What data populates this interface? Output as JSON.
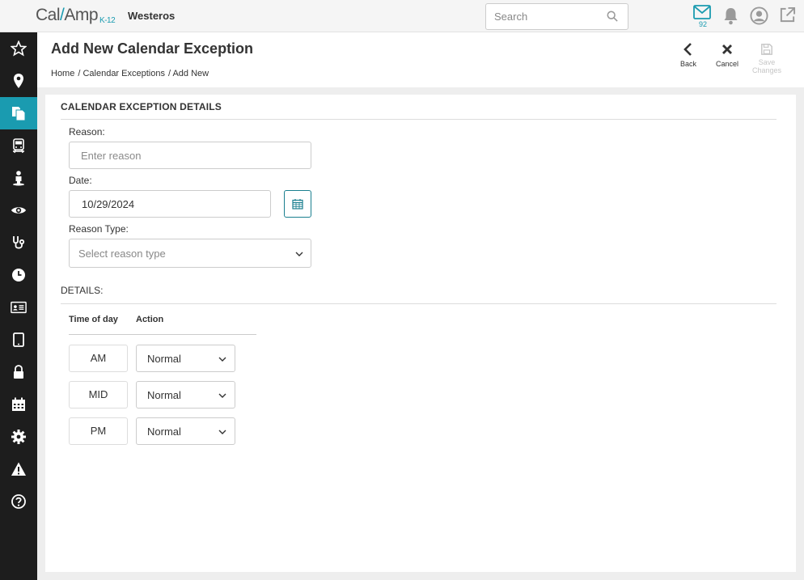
{
  "app": {
    "logo_text_a": "Cal",
    "logo_text_slash": "/",
    "logo_text_b": "Amp",
    "logo_suffix": "K-12",
    "district": "Westeros",
    "accent_color": "#1a9bb0"
  },
  "topbar": {
    "search_placeholder": "Search",
    "mail_count": "92",
    "icons": [
      "search-icon",
      "mail-icon",
      "bell-icon",
      "user-icon",
      "external-link-icon"
    ]
  },
  "sidebar": {
    "items": [
      {
        "icon": "star-icon"
      },
      {
        "icon": "map-pin-icon"
      },
      {
        "icon": "documents-icon",
        "active": true
      },
      {
        "icon": "bus-icon"
      },
      {
        "icon": "person-icon"
      },
      {
        "icon": "eye-icon"
      },
      {
        "icon": "stethoscope-icon"
      },
      {
        "icon": "clock-icon"
      },
      {
        "icon": "id-card-icon"
      },
      {
        "icon": "tablet-icon"
      },
      {
        "icon": "lock-icon"
      },
      {
        "icon": "calendar-icon"
      },
      {
        "icon": "gear-icon"
      },
      {
        "icon": "warning-icon"
      },
      {
        "icon": "help-icon"
      }
    ]
  },
  "header": {
    "title": "Add New Calendar Exception",
    "breadcrumb": [
      "Home",
      "/ Calendar Exceptions",
      "/ Add New"
    ],
    "actions": {
      "back": "Back",
      "cancel": "Cancel",
      "save_line1": "Save",
      "save_line2": "Changes"
    }
  },
  "form": {
    "section_title": "CALENDAR EXCEPTION DETAILS",
    "reason_label": "Reason:",
    "reason_placeholder": "Enter reason",
    "date_label": "Date:",
    "date_value": "10/29/2024",
    "reason_type_label": "Reason Type:",
    "reason_type_placeholder": "Select reason type",
    "details_label": "DETAILS:",
    "columns": {
      "time_of_day": "Time of day",
      "action": "Action"
    },
    "rows": [
      {
        "time": "AM",
        "action": "Normal"
      },
      {
        "time": "MID",
        "action": "Normal"
      },
      {
        "time": "PM",
        "action": "Normal"
      }
    ]
  }
}
